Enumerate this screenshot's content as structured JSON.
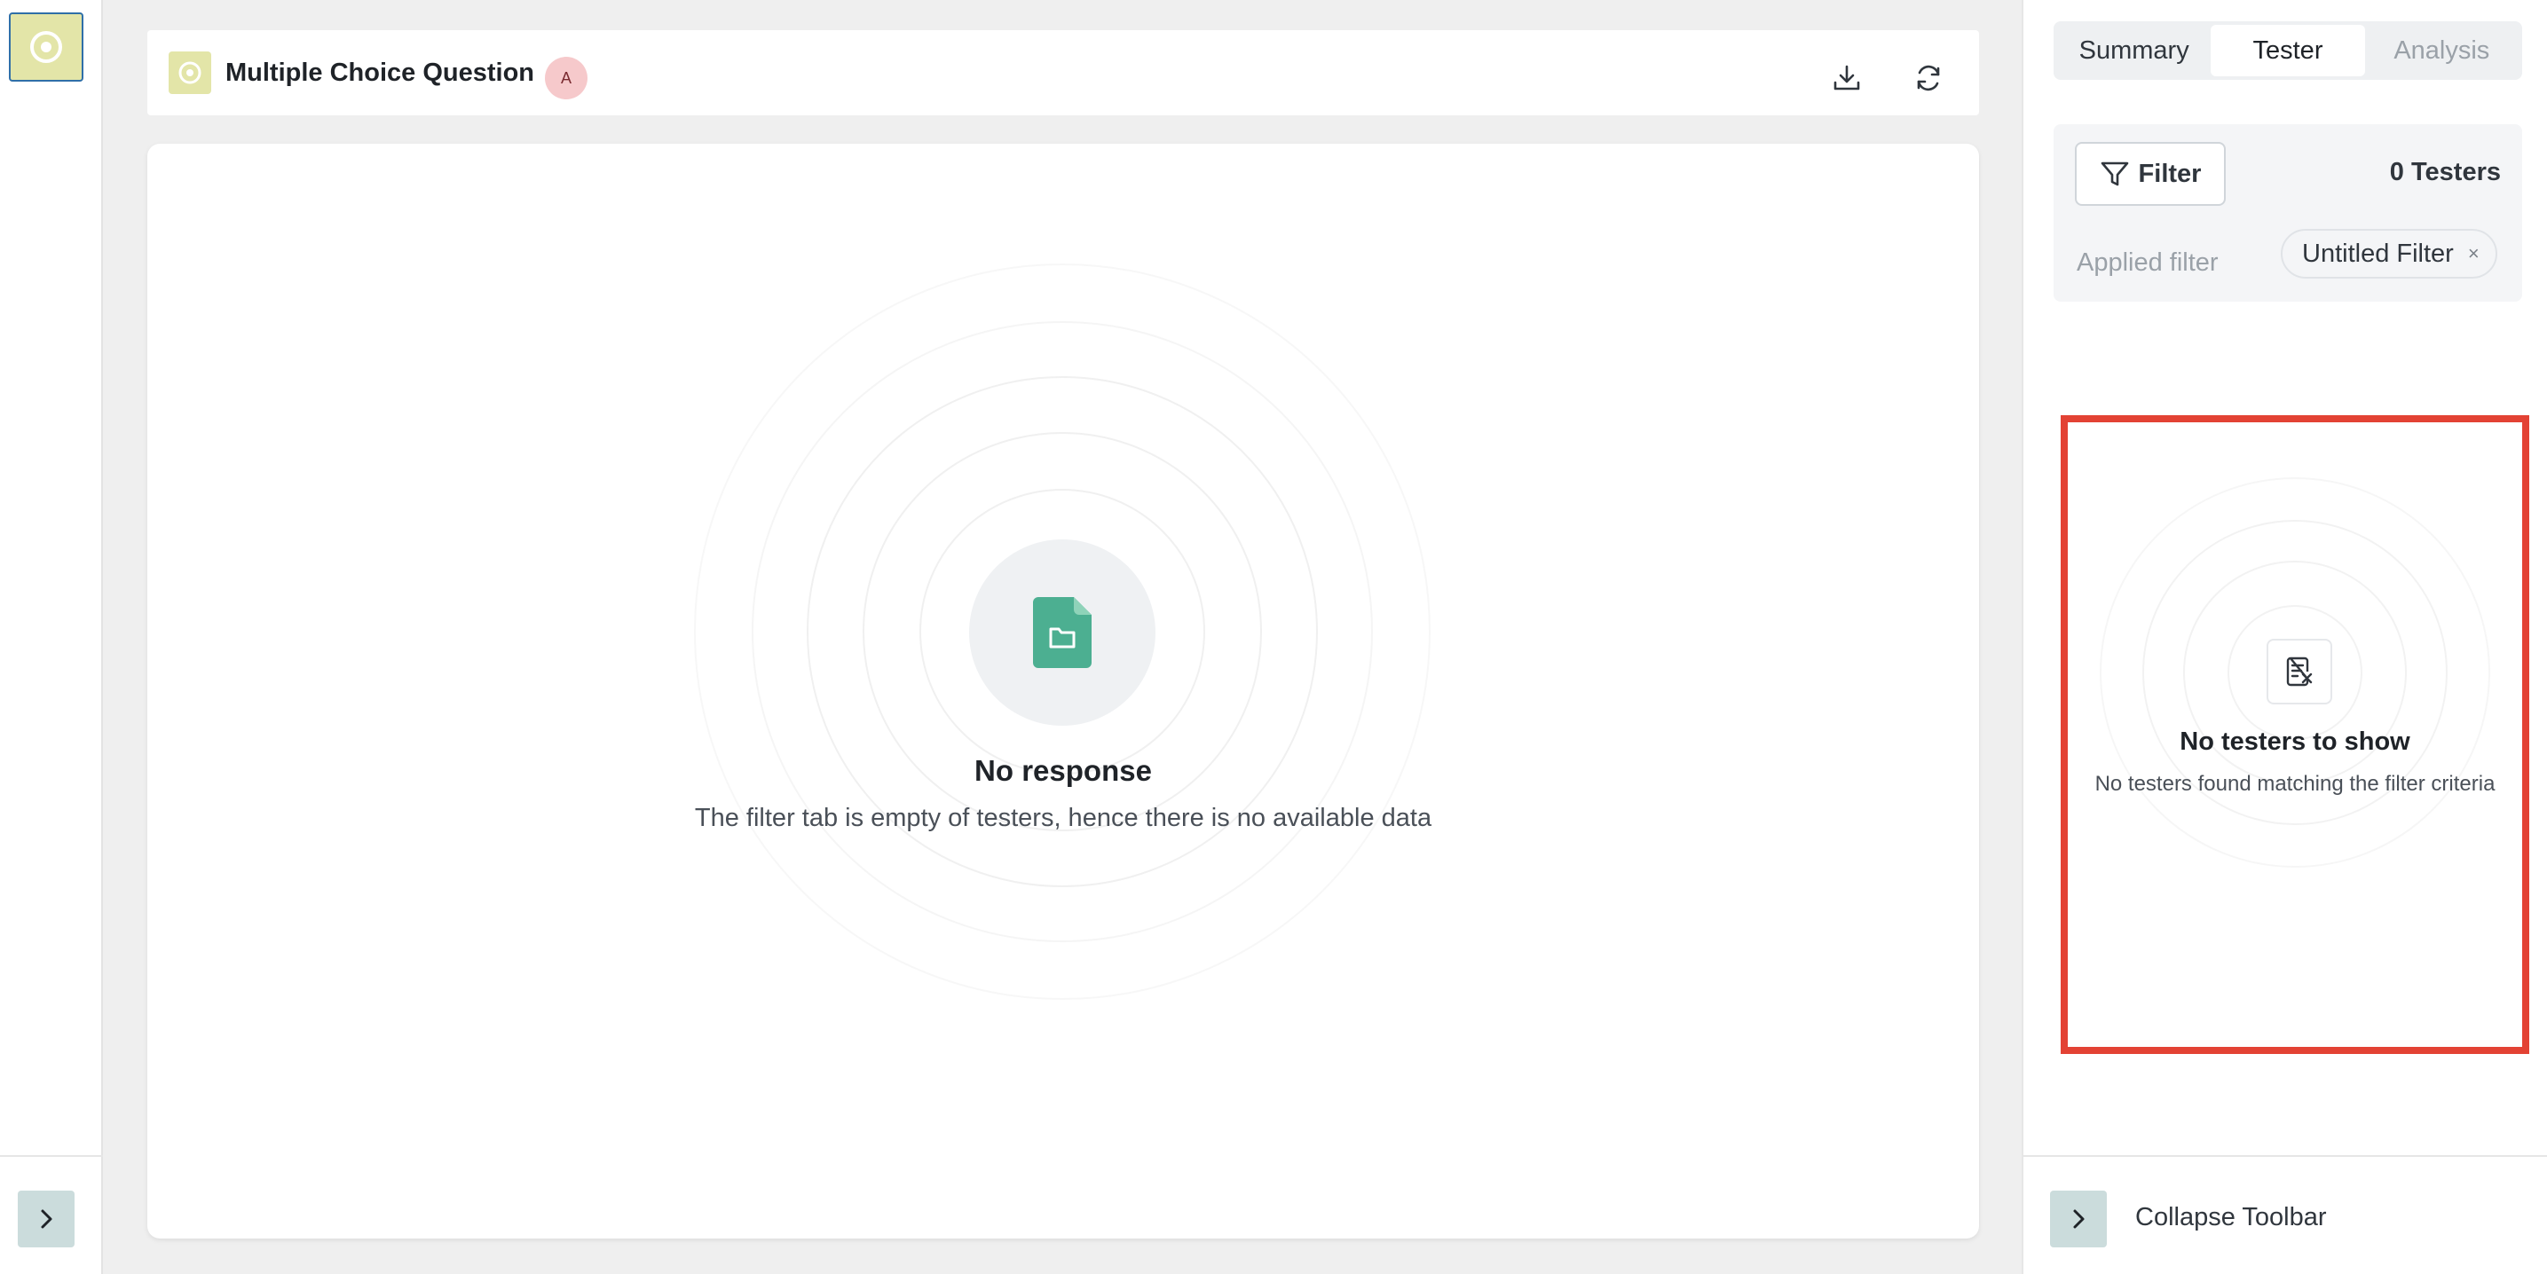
{
  "header": {
    "title": "Multiple Choice Question",
    "avatar_initial": "A",
    "download_icon": "download-icon",
    "refresh_icon": "refresh-icon"
  },
  "main": {
    "empty_icon": "folder-file-icon",
    "empty_title": "No response",
    "empty_description": "The filter tab is empty of testers, hence there is no available data"
  },
  "right_panel": {
    "tabs": [
      {
        "label": "Summary",
        "state": "normal"
      },
      {
        "label": "Tester",
        "state": "active"
      },
      {
        "label": "Analysis",
        "state": "disabled"
      }
    ],
    "filter_button_label": "Filter",
    "testers_count": "0 Testers",
    "applied_filter_label": "Applied filter",
    "applied_filter_chip": "Untitled Filter",
    "chip_close": "×",
    "empty_title": "No testers to show",
    "empty_description": "No testers found matching the filter criteria",
    "collapse_label": "Collapse Toolbar"
  },
  "colors": {
    "accent_green": "#4caf91",
    "thumb_yellow": "#e3e5a8",
    "highlight_red": "#e34234",
    "avatar_pink": "#f6c9cb"
  }
}
